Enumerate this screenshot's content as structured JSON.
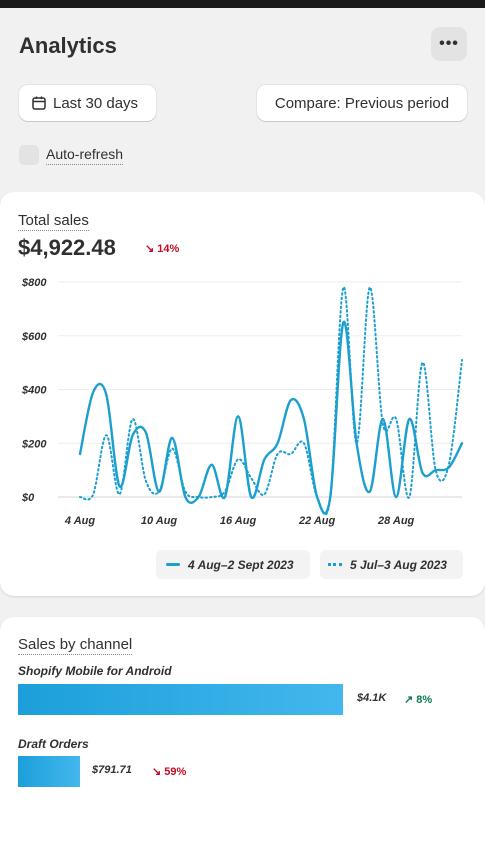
{
  "header": {
    "title": "Analytics",
    "more_label": "•••"
  },
  "filters": {
    "date_label": "Last 30 days",
    "compare_label": "Compare: Previous period",
    "auto_refresh_label": "Auto-refresh",
    "auto_refresh_checked": false
  },
  "total_sales": {
    "title": "Total sales",
    "value": "$4,922.48",
    "change": "↘ 14%"
  },
  "chart_data": {
    "type": "line",
    "y_ticks": [
      "$800",
      "$600",
      "$400",
      "$200",
      "$0"
    ],
    "y_tick_values": [
      800,
      600,
      400,
      200,
      0
    ],
    "ylim": [
      0,
      800
    ],
    "x_ticks": [
      "4 Aug",
      "10 Aug",
      "16 Aug",
      "22 Aug",
      "28 Aug"
    ],
    "x_tick_index": [
      0,
      6,
      12,
      18,
      24
    ],
    "series": [
      {
        "name": "4 Aug–2 Sept 2023",
        "style": "solid",
        "color": "#1b9fcf",
        "values": [
          160,
          390,
          380,
          40,
          230,
          240,
          20,
          220,
          0,
          0,
          120,
          0,
          300,
          0,
          140,
          200,
          360,
          290,
          0,
          0,
          650,
          200,
          20,
          290,
          0,
          290,
          90,
          100,
          110,
          200
        ]
      },
      {
        "name": "5 Jul–3 Aug 2023",
        "style": "dotted",
        "color": "#1b9fcf",
        "values": [
          0,
          10,
          230,
          10,
          290,
          60,
          20,
          180,
          20,
          0,
          0,
          20,
          140,
          70,
          10,
          160,
          160,
          200,
          0,
          0,
          780,
          200,
          780,
          270,
          290,
          0,
          500,
          100,
          120,
          510
        ]
      }
    ]
  },
  "channels": {
    "title": "Sales by channel",
    "items": [
      {
        "name": "Shopify Mobile for Android",
        "value": "$4.1K",
        "change": "↗ 8%",
        "fraction": 0.84,
        "trend": "up"
      },
      {
        "name": "Draft Orders",
        "value": "$791.71",
        "change": "↘ 59%",
        "fraction": 0.16,
        "trend": "down"
      }
    ]
  }
}
